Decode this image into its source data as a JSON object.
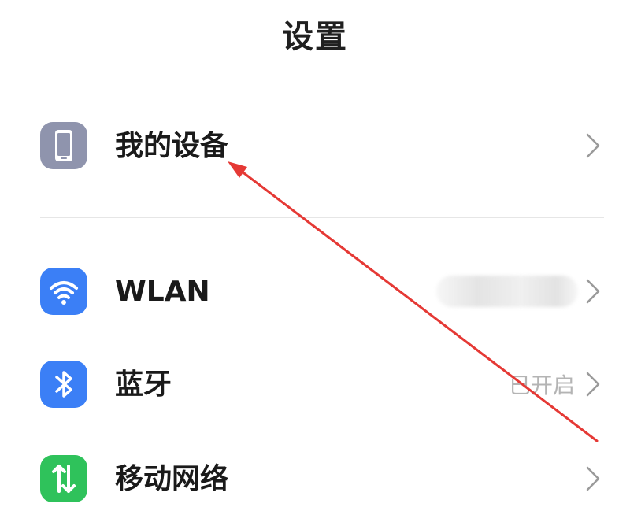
{
  "header": {
    "title": "设置"
  },
  "items": [
    {
      "label": "我的设备",
      "icon": "phone-device-icon",
      "icon_color": "#8f94ad",
      "value": ""
    },
    {
      "label": "WLAN",
      "icon": "wifi-icon",
      "icon_color": "#3b7ff6",
      "value": ""
    },
    {
      "label": "蓝牙",
      "icon": "bluetooth-icon",
      "icon_color": "#3b7ff6",
      "value": "已开启"
    },
    {
      "label": "移动网络",
      "icon": "mobile-network-icon",
      "icon_color": "#2fc25b",
      "value": ""
    }
  ],
  "colors": {
    "annotation_arrow": "#e53935",
    "divider": "#e6e6e6",
    "chevron": "#9a9a9a"
  }
}
